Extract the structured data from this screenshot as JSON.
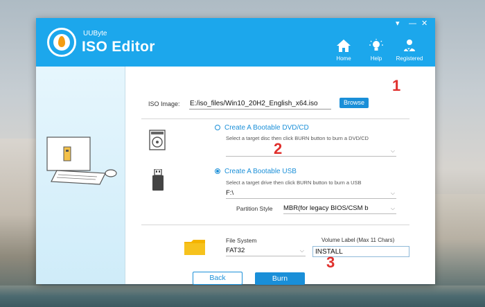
{
  "window": {
    "brand": "UUByte",
    "product": "ISO Editor"
  },
  "nav": {
    "home": "Home",
    "help": "Help",
    "registered": "Registered"
  },
  "iso": {
    "label": "ISO Image:",
    "path": "E:/iso_files/Win10_20H2_English_x64.iso",
    "browse": "Browse"
  },
  "dvd": {
    "option": "Create A Bootable DVD/CD",
    "hint": "Select a target disc then click BURN button to burn a DVD/CD",
    "drive": ""
  },
  "usb": {
    "option": "Create A Bootable USB",
    "hint": "Select a target drive then click BURN button to burn a USB",
    "drive": "F:\\",
    "partition_label": "Partition Style",
    "partition_value": "MBR(for legacy BIOS/CSM b"
  },
  "fs": {
    "label": "File System",
    "value": "FAT32",
    "volume_label": "Volume Label (Max 11 Chars)",
    "volume_value": "INSTALL"
  },
  "buttons": {
    "back": "Back",
    "burn": "Burn"
  },
  "annotations": {
    "one": "1",
    "two": "2",
    "three": "3"
  },
  "colors": {
    "header": "#1ca7ec",
    "accent": "#1a8fd8",
    "annotation": "#e0302d"
  }
}
